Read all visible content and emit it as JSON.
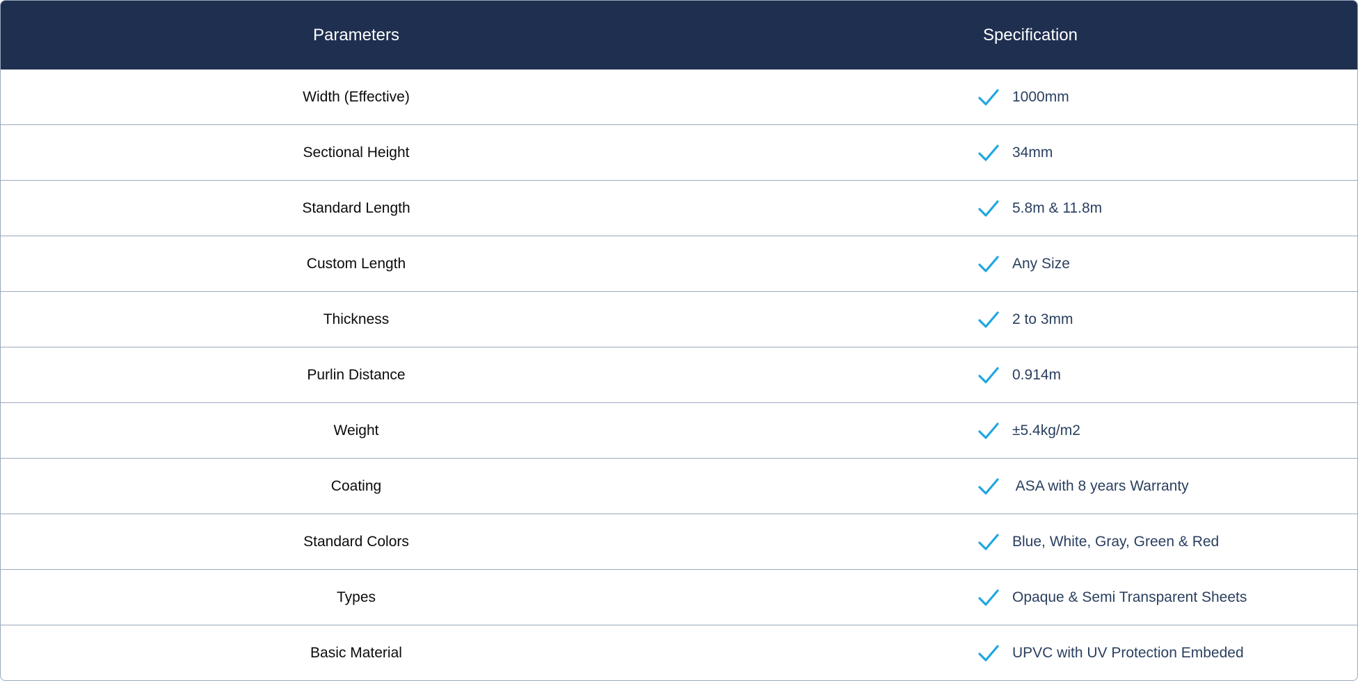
{
  "header": {
    "parameters_label": "Parameters",
    "specification_label": "Specification"
  },
  "accent_color": "#1fa7e0",
  "header_color": "#1f2f4f",
  "check_icon": "checkmark-icon",
  "rows": [
    {
      "parameter": "Width (Effective)",
      "specification": "1000mm"
    },
    {
      "parameter": "Sectional Height",
      "specification": "34mm"
    },
    {
      "parameter": "Standard Length",
      "specification": "5.8m & 11.8m"
    },
    {
      "parameter": "Custom Length",
      "specification": "Any Size"
    },
    {
      "parameter": "Thickness",
      "specification": "2 to 3mm"
    },
    {
      "parameter": "Purlin Distance",
      "specification": "0.914m"
    },
    {
      "parameter": "Weight",
      "specification": "±5.4kg/m2"
    },
    {
      "parameter": "Coating",
      "specification": " ASA with 8 years Warranty"
    },
    {
      "parameter": "Standard Colors",
      "specification": "Blue, White, Gray, Green & Red"
    },
    {
      "parameter": "Types",
      "specification": "Opaque & Semi Transparent Sheets"
    },
    {
      "parameter": "Basic Material",
      "specification": "UPVC with UV Protection Embeded"
    }
  ]
}
